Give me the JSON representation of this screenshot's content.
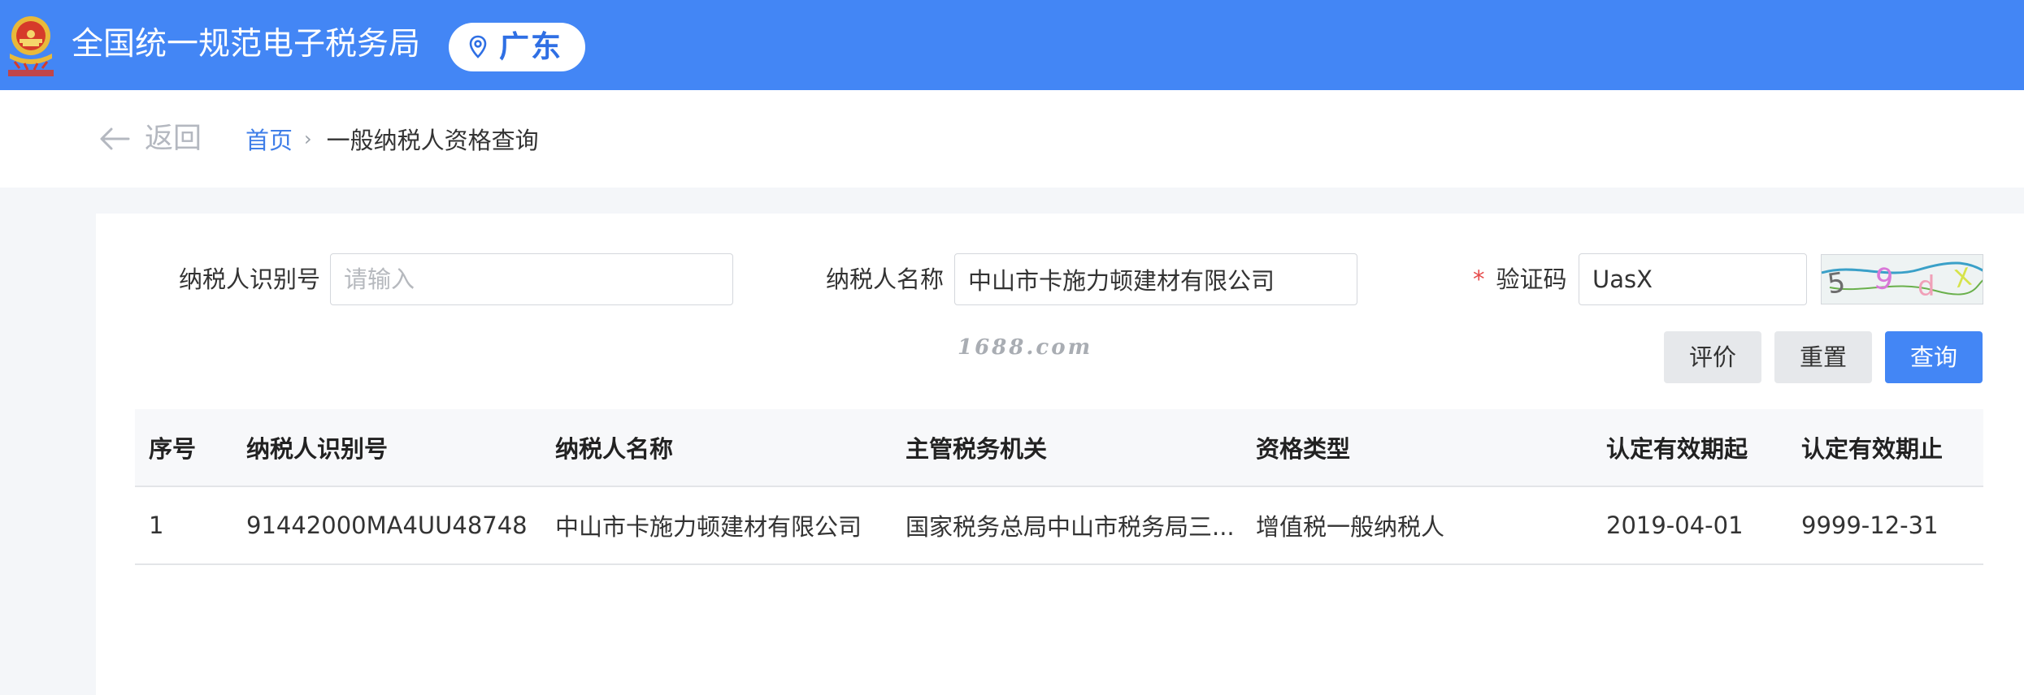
{
  "header": {
    "site_title": "全国统一规范电子税务局",
    "region": "广东",
    "emblem_icon": "national-emblem-icon",
    "pin_icon": "location-pin-icon",
    "bar_color": "#4386f5"
  },
  "nav": {
    "back_label": "返回",
    "back_icon": "arrow-left-icon",
    "breadcrumb_home": "首页",
    "breadcrumb_separator": "›",
    "breadcrumb_current": "一般纳税人资格查询"
  },
  "search": {
    "taxpayer_id_label": "纳税人识别号",
    "taxpayer_id_placeholder": "请输入",
    "taxpayer_id_value": "",
    "taxpayer_name_label": "纳税人名称",
    "taxpayer_name_value": "中山市卡施力顿建材有限公司",
    "captcha_required_mark": "*",
    "captcha_label": "验证码",
    "captcha_value": "UasX",
    "captcha_image_text": "59dX",
    "watermark": "1688.com",
    "rate_button": "评价",
    "reset_button": "重置",
    "query_button": "查询",
    "primary_color": "#4386f5"
  },
  "table": {
    "columns": [
      "序号",
      "纳税人识别号",
      "纳税人名称",
      "主管税务机关",
      "资格类型",
      "认定有效期起",
      "认定有效期止"
    ],
    "rows": [
      [
        "1",
        "91442000MA4UU48748",
        "中山市卡施力顿建材有限公司",
        "国家税务总局中山市税务局三...",
        "增值税一般纳税人",
        "2019-04-01",
        "9999-12-31"
      ]
    ]
  }
}
